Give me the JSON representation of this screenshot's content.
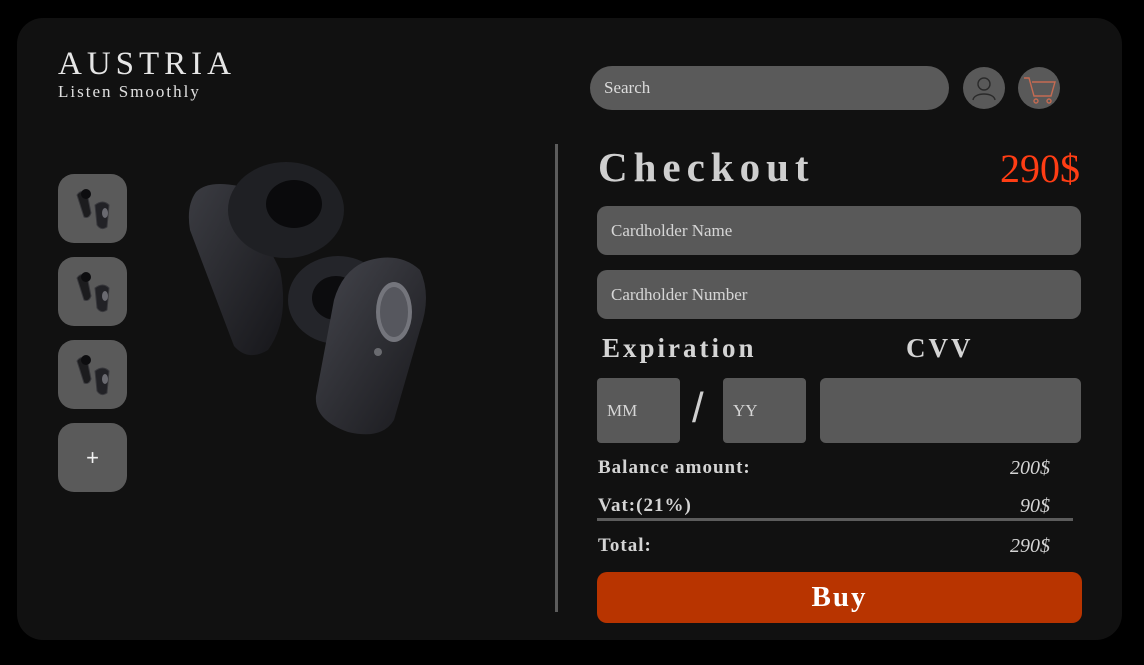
{
  "brand": {
    "title": "AUSTRIA",
    "subtitle": "Listen Smoothly"
  },
  "header": {
    "search_placeholder": "Search",
    "user_icon": "user-icon",
    "cart_icon": "cart-icon"
  },
  "gallery": {
    "thumbnails": [
      "earbuds-thumbnail",
      "earbuds-thumbnail",
      "earbuds-thumbnail"
    ],
    "add_label": "+"
  },
  "checkout": {
    "title": "Checkout",
    "price": "290$",
    "cardholder_name_placeholder": "Cardholder Name",
    "cardholder_number_placeholder": "Cardholder Number",
    "expiration_label": "Expiration",
    "cvv_label": "CVV",
    "mm_placeholder": "MM",
    "yy_placeholder": "YY",
    "separator": "/",
    "balance_label": "Balance amount:",
    "balance_value": "200$",
    "vat_label": "Vat:(21%)",
    "vat_value": "90$",
    "total_label": "Total:",
    "total_value": "290$",
    "buy_label": "Buy"
  },
  "colors": {
    "accent": "#b83400",
    "price": "#ff3d14",
    "background": "#111111",
    "field": "#595959"
  }
}
